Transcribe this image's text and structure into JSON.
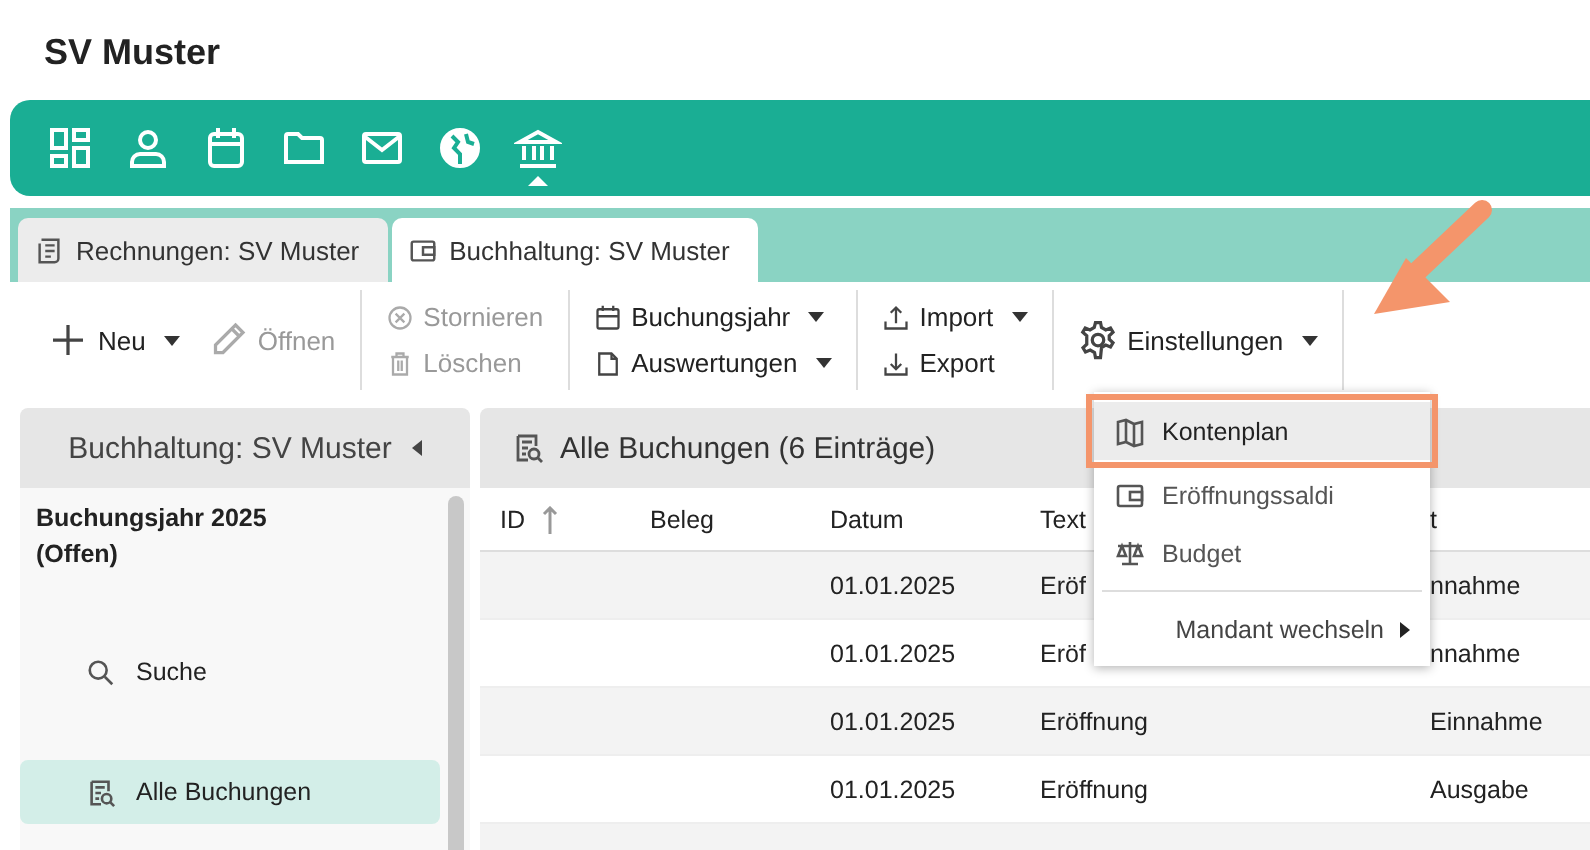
{
  "window": {
    "title": "SV Muster"
  },
  "nav": {
    "icons": [
      {
        "kind": "dashboard",
        "selected": false
      },
      {
        "kind": "person",
        "selected": false
      },
      {
        "kind": "calendar",
        "selected": false
      },
      {
        "kind": "folder",
        "selected": false
      },
      {
        "kind": "mail",
        "selected": false
      },
      {
        "kind": "globe",
        "selected": false
      },
      {
        "kind": "bank",
        "selected": true
      }
    ]
  },
  "tabs": [
    {
      "label": "Rechnungen: SV Muster",
      "kind": "invoice",
      "selected": false
    },
    {
      "label": "Buchhaltung: SV Muster",
      "kind": "wallet",
      "selected": true
    }
  ],
  "toolbar": {
    "groups": [
      {
        "items": [
          {
            "label": "Neu",
            "kind": "plus",
            "dropdown": true,
            "disabled": false
          },
          {
            "label": "Öffnen",
            "kind": "pencil",
            "dropdown": false,
            "disabled": true
          }
        ]
      },
      {
        "items": [
          {
            "label": "Stornieren",
            "kind": "cancel",
            "dropdown": false,
            "disabled": true
          },
          {
            "label": "Löschen",
            "kind": "trash",
            "dropdown": false,
            "disabled": true
          }
        ]
      },
      {
        "items": [
          {
            "label": "Buchungsjahr",
            "kind": "calendar",
            "dropdown": true,
            "disabled": false
          },
          {
            "label": "Auswertungen",
            "kind": "document",
            "dropdown": true,
            "disabled": false
          }
        ]
      },
      {
        "items": [
          {
            "label": "Import",
            "kind": "upload",
            "dropdown": true,
            "disabled": false
          },
          {
            "label": "Export",
            "kind": "download",
            "dropdown": false,
            "disabled": false
          }
        ]
      },
      {
        "items": [
          {
            "label": "Einstellungen",
            "kind": "gear",
            "dropdown": true,
            "disabled": false
          }
        ]
      }
    ]
  },
  "menu": {
    "items": [
      {
        "label": "Kontenplan",
        "kind": "map",
        "selected": true
      },
      {
        "label": "Eröffnungssaldi",
        "kind": "wallet",
        "selected": false
      },
      {
        "label": "Budget",
        "kind": "scale",
        "selected": false
      },
      {
        "label": "Mandant wechseln",
        "kind": "submenu",
        "selected": false
      }
    ]
  },
  "sidebar": {
    "title": "Buchhaltung: SV Muster",
    "year": "Buchungsjahr 2025\n(Offen)",
    "items": [
      {
        "label": "Suche",
        "kind": "search",
        "selected": false
      },
      {
        "label": "Alle Buchungen",
        "kind": "list",
        "selected": true
      }
    ]
  },
  "table": {
    "title": "Alle Buchungen (6 Einträge)",
    "columns": [
      "ID",
      "Beleg",
      "Datum",
      "Text",
      "t"
    ],
    "rows": [
      [
        "",
        "",
        "01.01.2025",
        "Eröf",
        "nnahme"
      ],
      [
        "",
        "",
        "01.01.2025",
        "Eröf",
        "nnahme"
      ],
      [
        "",
        "",
        "01.01.2025",
        "Eröffnung",
        "Einnahme"
      ],
      [
        "",
        "",
        "01.01.2025",
        "Eröffnung",
        "Ausgabe"
      ]
    ]
  }
}
